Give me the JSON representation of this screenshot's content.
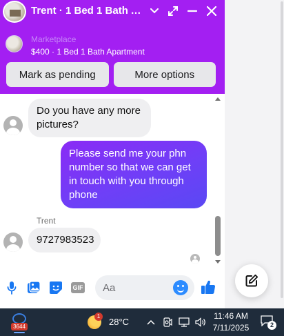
{
  "chat_window": {
    "title": "Trent · 1 Bed 1 Bath Ap...",
    "marketplace_label": "Marketplace",
    "listing_line": "$400 · 1 Bed 1 Bath Apartment",
    "mark_pending_label": "Mark as pending",
    "more_options_label": "More options",
    "accent_color": "#a31ff2"
  },
  "messages": {
    "incoming_1": "Do you have any more pictures?",
    "outgoing_1": "Please send me your phn number so that we can get in touch with you through phone",
    "sender_name": "Trent",
    "incoming_2": "9727983523"
  },
  "composer": {
    "placeholder": "Aa",
    "gif_label": "GIF",
    "icons": [
      "microphone-icon",
      "photo-icon",
      "sticker-icon",
      "gif-icon",
      "emoji-icon",
      "thumbs-up-icon"
    ]
  },
  "taskbar": {
    "app_badge": "3644",
    "weather_badge": "1",
    "temperature": "28°C",
    "time": "11:46 AM",
    "date": "7/11/2025",
    "notification_count": "2"
  }
}
